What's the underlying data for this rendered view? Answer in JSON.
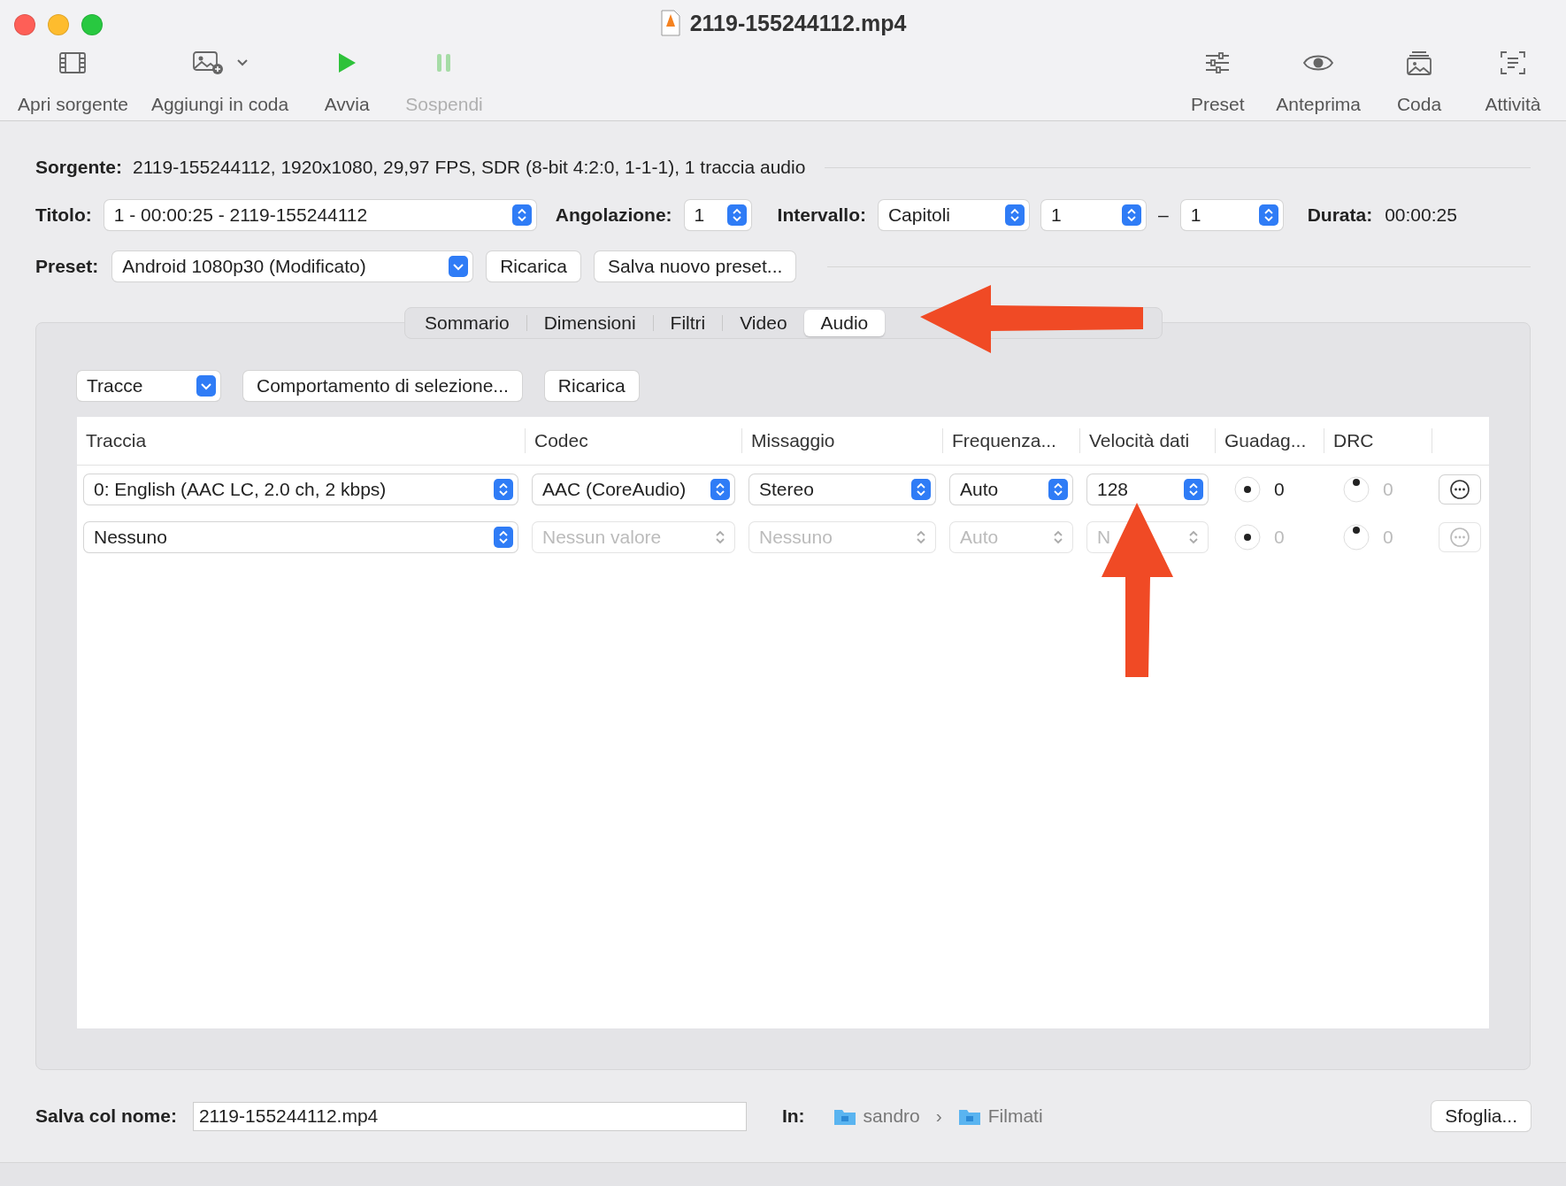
{
  "window": {
    "title": "2119-155244112.mp4"
  },
  "toolbar": {
    "left": [
      {
        "label": "Apri sorgente",
        "kind": "film",
        "disabled": false,
        "menu": false
      },
      {
        "label": "Aggiungi in coda",
        "kind": "add-image",
        "disabled": false,
        "menu": true
      },
      {
        "label": "Avvia",
        "kind": "play",
        "disabled": false,
        "menu": false
      },
      {
        "label": "Sospendi",
        "kind": "pause",
        "disabled": true,
        "menu": false
      }
    ],
    "right": [
      {
        "label": "Preset",
        "kind": "sliders",
        "disabled": false,
        "menu": false
      },
      {
        "label": "Anteprima",
        "kind": "eye",
        "disabled": false,
        "menu": false
      },
      {
        "label": "Coda",
        "kind": "stack",
        "disabled": false,
        "menu": false
      },
      {
        "label": "Attività",
        "kind": "log",
        "disabled": false,
        "menu": false
      }
    ]
  },
  "source": {
    "label": "Sorgente:",
    "value": "2119-155244112, 1920x1080, 29,97 FPS, SDR (8-bit 4:2:0, 1-1-1), 1 traccia audio"
  },
  "title_row": {
    "title": {
      "label": "Titolo:",
      "value": "1 - 00:00:25 - 2119-155244112"
    },
    "angle": {
      "label": "Angolazione:",
      "value": "1"
    },
    "range": {
      "label": "Intervallo:",
      "mode": "Capitoli",
      "from": "1",
      "separator": "–",
      "to": "1"
    },
    "duration": {
      "label": "Durata:",
      "value": "00:00:25"
    }
  },
  "preset_row": {
    "label": "Preset:",
    "value": "Android 1080p30 (Modificato)",
    "buttons": [
      "Ricarica",
      "Salva nuovo preset..."
    ]
  },
  "tabs": [
    {
      "label": "Sommario",
      "selected": false
    },
    {
      "label": "Dimensioni",
      "selected": false
    },
    {
      "label": "Filtri",
      "selected": false
    },
    {
      "label": "Video",
      "selected": false
    },
    {
      "label": "Audio",
      "selected": true
    }
  ],
  "audio": {
    "tracks_select": "Tracce",
    "buttons": [
      "Comportamento di selezione...",
      "Ricarica"
    ],
    "columns": [
      "Traccia",
      "Codec",
      "Missaggio",
      "Frequenza...",
      "Velocità dati",
      "Guadag...",
      "DRC"
    ],
    "rows": [
      {
        "track": "0: English (AAC LC, 2.0 ch, 2 kbps)",
        "codec": "AAC (CoreAudio)",
        "mixdown": "Stereo",
        "samplerate": "Auto",
        "bitrate": "128",
        "gain": "0",
        "drc": "0",
        "disabled": false
      },
      {
        "track": "Nessuno",
        "codec": "Nessun valore",
        "mixdown": "Nessuno",
        "samplerate": "Auto",
        "bitrate": "N",
        "gain": "0",
        "drc": "0",
        "disabled": true
      }
    ]
  },
  "destination": {
    "label": "Salva col nome:",
    "value": "2119-155244112.mp4",
    "in_label": "In:",
    "path": [
      "sandro",
      "Filmati"
    ],
    "separator": "›",
    "browse": "Sfoglia..."
  },
  "annotations": [
    {
      "kind": "arrow-left"
    },
    {
      "kind": "arrow-up"
    }
  ]
}
